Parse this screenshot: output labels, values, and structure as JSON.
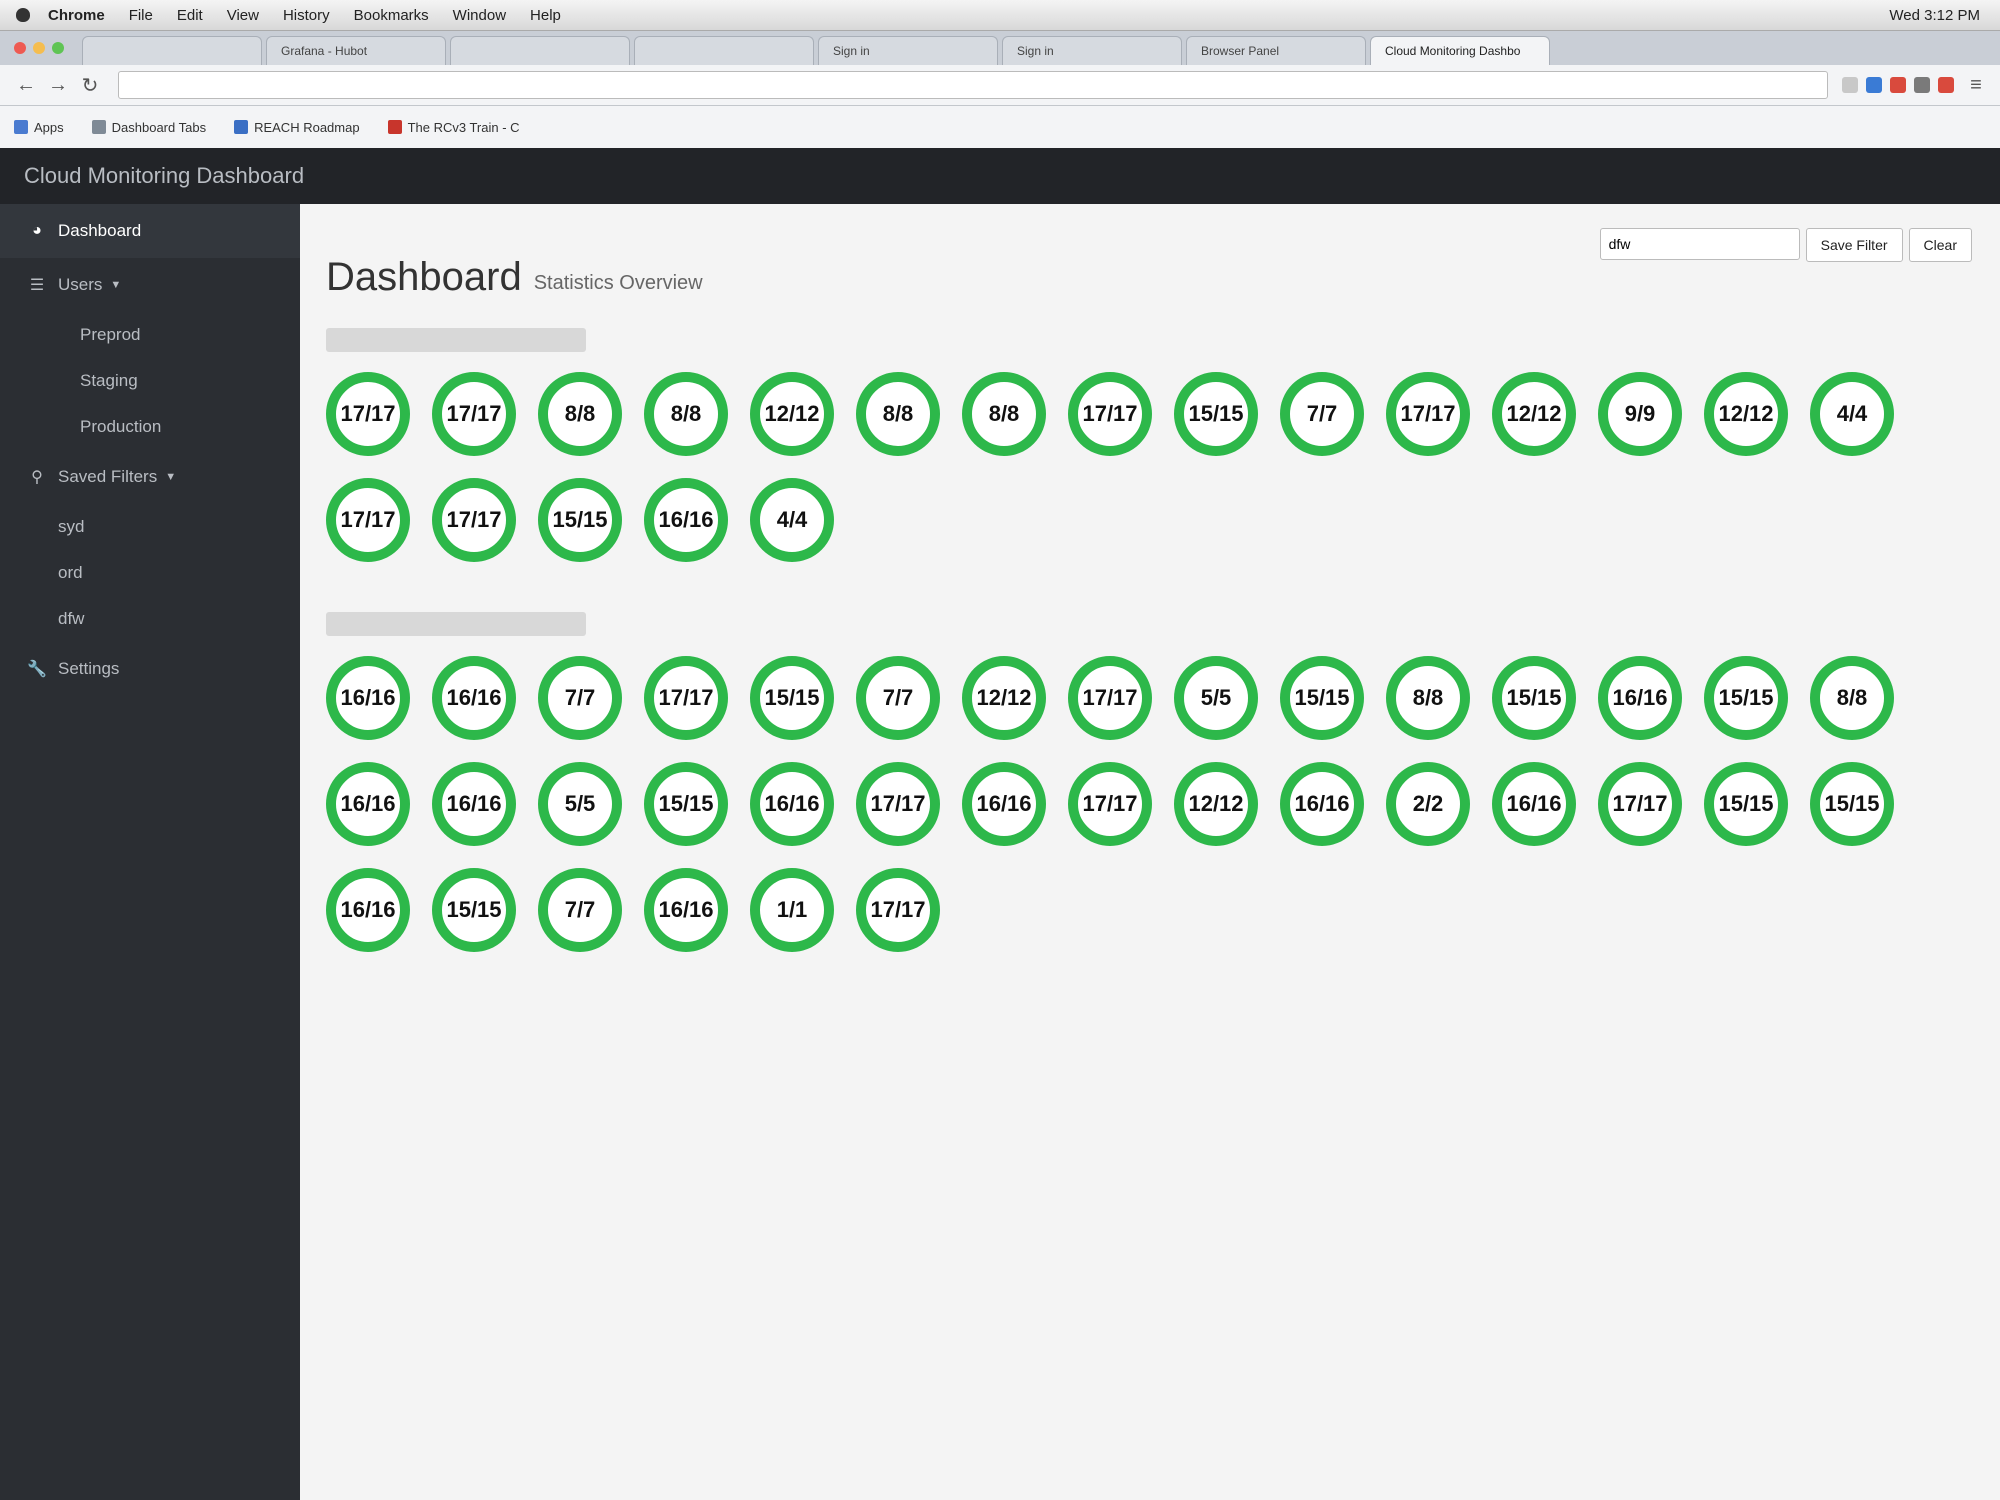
{
  "menubar": {
    "items": [
      "Chrome",
      "File",
      "Edit",
      "View",
      "History",
      "Bookmarks",
      "Window",
      "Help"
    ],
    "clock": "Wed 3:12 PM"
  },
  "tabs": [
    "Grafana - Hubot",
    "Sign in",
    "Sign in",
    "Browser Panel",
    "Cloud Monitoring Dashbo"
  ],
  "bookmarks": [
    "Apps",
    "Dashboard Tabs",
    "REACH Roadmap",
    "The RCv3 Train - C"
  ],
  "brand": "Cloud Monitoring Dashboard",
  "sidebar": {
    "dashboard": "Dashboard",
    "users": "Users",
    "user_items": [
      "Preprod",
      "Staging",
      "Production"
    ],
    "saved_filters": "Saved Filters",
    "filters": [
      "syd",
      "ord",
      "dfw"
    ],
    "settings": "Settings"
  },
  "page": {
    "title": "Dashboard",
    "subtitle": "Statistics Overview"
  },
  "filter": {
    "value": "dfw",
    "save_label": "Save Filter",
    "clear_label": "Clear"
  },
  "groups": [
    {
      "circles": [
        "17/17",
        "17/17",
        "8/8",
        "8/8",
        "12/12",
        "8/8",
        "8/8",
        "17/17",
        "15/15",
        "7/7",
        "17/17",
        "12/12",
        "9/9",
        "12/12",
        "4/4",
        "17/17",
        "17/17",
        "15/15",
        "16/16",
        "4/4"
      ]
    },
    {
      "circles": [
        "16/16",
        "16/16",
        "7/7",
        "17/17",
        "15/15",
        "7/7",
        "12/12",
        "17/17",
        "5/5",
        "15/15",
        "8/8",
        "15/15",
        "16/16",
        "15/15",
        "8/8",
        "16/16",
        "16/16",
        "5/5",
        "15/15",
        "16/16",
        "17/17",
        "16/16",
        "17/17",
        "12/12",
        "16/16",
        "2/2",
        "16/16",
        "17/17",
        "15/15",
        "15/15",
        "16/16",
        "15/15",
        "7/7",
        "16/16",
        "1/1",
        "17/17"
      ]
    }
  ],
  "colors": {
    "ok": "#2db84a",
    "sidebar": "#2b2e33",
    "navbar": "#222428"
  }
}
